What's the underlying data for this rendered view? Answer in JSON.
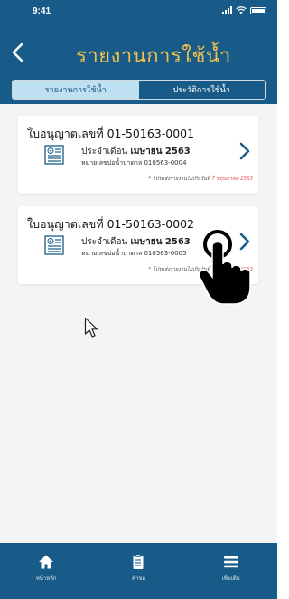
{
  "status_bar": {
    "time": "9:41"
  },
  "header": {
    "title": "รายงานการใช้น้ำ"
  },
  "tabs": [
    {
      "label": "รายงานการใช้น้ำ",
      "active": true
    },
    {
      "label": "ประวัติการใช้น้ำ",
      "active": false
    }
  ],
  "reports": [
    {
      "title": "ใบอนุญาตเลขที่ 01-50163-0001",
      "month_prefix": "ประจำเดือน",
      "month": "เมษายน 2563",
      "well": "หมายเลขบ่อน้ำบาดาล 010563-0004",
      "note": "* โปรดส่งรายงานไม่เกินวันที่",
      "due": "7 พฤษภาคม 2563"
    },
    {
      "title": "ใบอนุญาตเลขที่ 01-50163-0002",
      "month_prefix": "ประจำเดือน",
      "month": "เมษายน 2563",
      "well": "หมายเลขบ่อน้ำบาดาล 010563-0005",
      "note": "* โปรดส่งรายงานไม่เกินวันที่",
      "due": "7 พฤษภาคม 2563"
    }
  ],
  "bottom_nav": [
    {
      "label": "หน้าหลัก",
      "icon": "home-icon"
    },
    {
      "label": "คำขอ",
      "icon": "clipboard-icon"
    },
    {
      "label": "เพิ่มเติม",
      "icon": "menu-icon"
    }
  ],
  "colors": {
    "primary": "#185b88",
    "accent": "#f1c24a",
    "tab_active": "#bfe0f0",
    "due_red": "#e05555"
  }
}
